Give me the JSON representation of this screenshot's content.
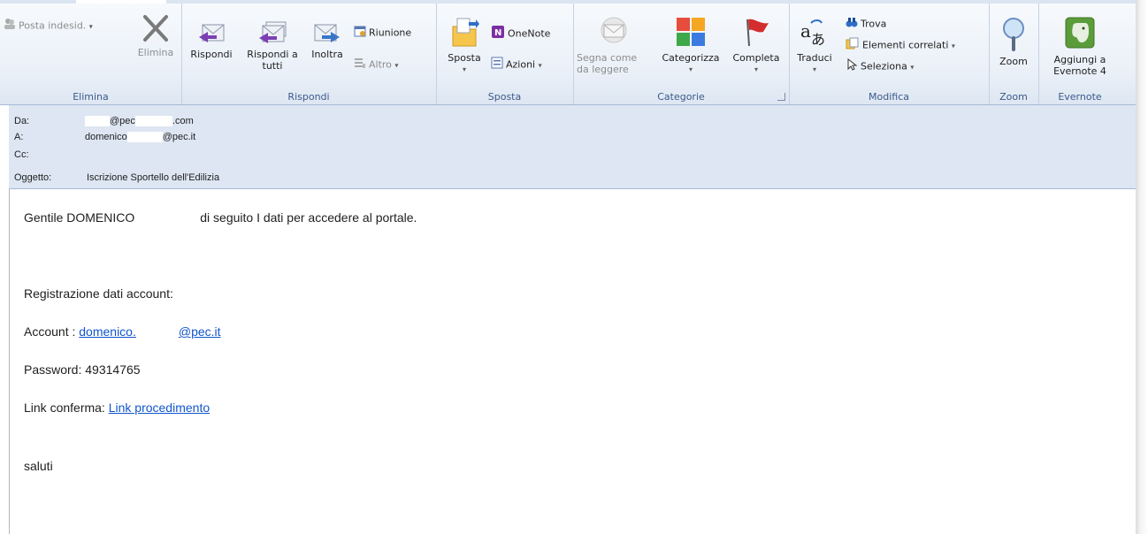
{
  "ribbon": {
    "groups": {
      "elimina": {
        "label": "Elimina",
        "junk": "Posta indesid.",
        "delete": "Elimina"
      },
      "rispondi": {
        "label": "Rispondi",
        "reply": "Rispondi",
        "reply_all": "Rispondi a tutti",
        "forward": "Inoltra",
        "meeting": "Riunione",
        "more": "Altro"
      },
      "sposta": {
        "label": "Sposta",
        "move": "Sposta",
        "onenote": "OneNote",
        "actions": "Azioni"
      },
      "categorie": {
        "label": "Categorie",
        "mark_unread": "Segna come da leggere",
        "categorize": "Categorizza",
        "followup": "Completa"
      },
      "modifica": {
        "label": "Modifica",
        "translate": "Traduci",
        "find": "Trova",
        "related": "Elementi correlati",
        "select": "Seleziona"
      },
      "zoom": {
        "label": "Zoom",
        "zoom": "Zoom"
      },
      "evernote": {
        "label": "Evernote",
        "add": "Aggiungi a Evernote 4"
      }
    }
  },
  "header": {
    "from_label": "Da:",
    "from_pre": "@pec",
    "from_post": ".com",
    "to_label": "A:",
    "to_pre": "domenico",
    "to_post": "@pec.it",
    "cc_label": "Cc:",
    "subject_label": "Oggetto:",
    "subject": "Iscrizione Sportello dell'Edilizia"
  },
  "body": {
    "greeting_name": "Gentile DOMENICO",
    "greeting_rest": "di seguito I dati per accedere al portale.",
    "registration": "Registrazione dati account:",
    "account_label": "Account :",
    "account_pre": "domenico.",
    "account_post": "@pec.it",
    "password": "Password: 49314765",
    "link_label": "Link conferma:",
    "link_text": "Link procedimento",
    "closing": "saluti"
  },
  "colors": {
    "ribbon_bg": "#eaf0f8",
    "header_bg": "#dde6f2",
    "link": "#1155cc",
    "group_label": "#3c5a8a"
  }
}
